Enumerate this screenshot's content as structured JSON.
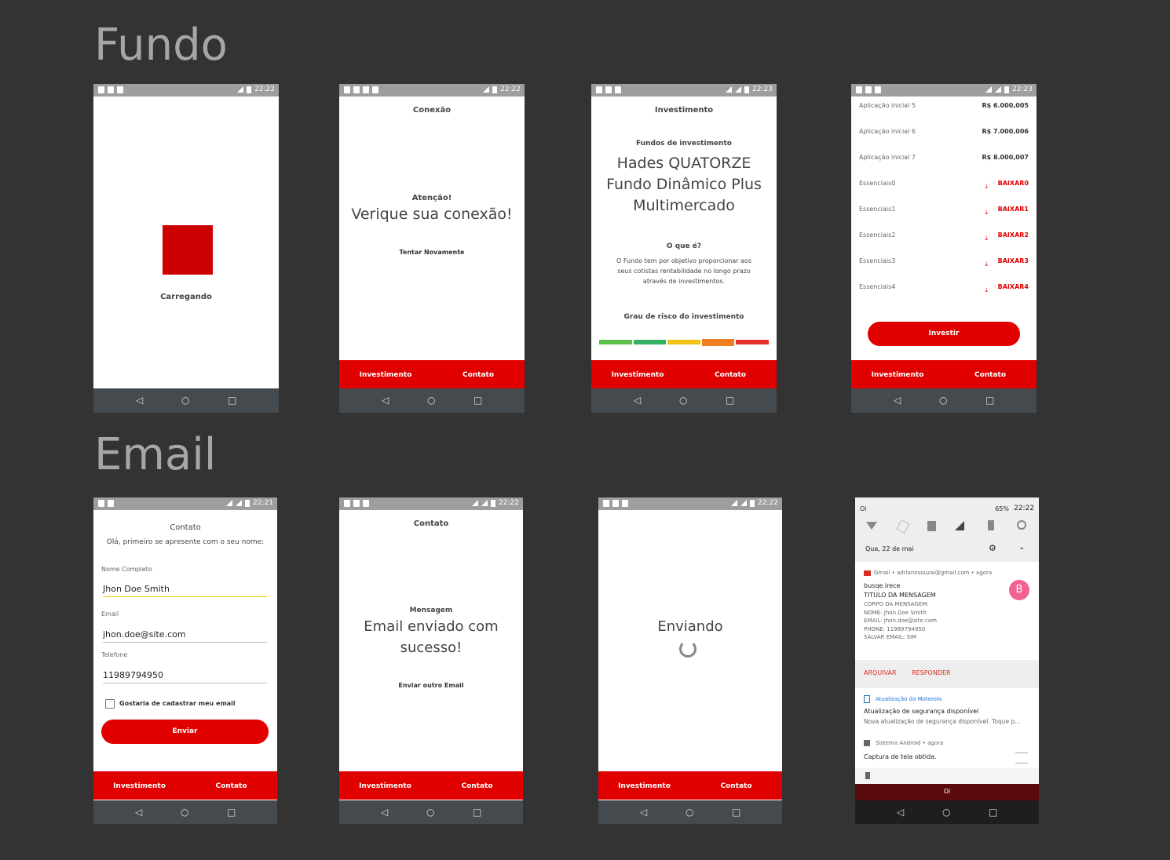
{
  "sections": {
    "fundo": "Fundo",
    "email": "Email"
  },
  "status_times": {
    "t2222": "22:22",
    "t2223": "22:23",
    "t2221": "22:21"
  },
  "tabs": {
    "left": "Investimento",
    "right": "Contato"
  },
  "nav_icons": {
    "back": "◁",
    "home": "○",
    "recent": "□"
  },
  "colors": {
    "accent": "#e10000",
    "background": "#333333",
    "loading_square": "#cc0000"
  },
  "loading": {
    "label": "Carregando"
  },
  "connection": {
    "header": "Conexão",
    "attention": "Atenção!",
    "message": "Verique sua conexão!",
    "retry": "Tentar Novamente"
  },
  "investment": {
    "header": "Investimento",
    "subtitle": "Fundos de investimento",
    "fund_line1": "Hades QUATORZE",
    "fund_line2": "Fundo Dinâmico Plus",
    "fund_line3": "Multimercado",
    "what_title": "O que é?",
    "what_line1": "O Fundo tem por objetivo proporcionar aos",
    "what_line2": "seus cotistas rentabilidade no longo prazo",
    "what_line3": "através de investimentos.",
    "risk_title": "Grau de risco do investimento",
    "risk_colors": [
      "#5cc24a",
      "#33b060",
      "#f2c315",
      "#f07f22",
      "#e8302a"
    ],
    "risk_level": 4
  },
  "investment_list": {
    "rows": [
      {
        "label": "Aplicação inicial 5",
        "value": "R$ 6.000,005"
      },
      {
        "label": "Aplicação inicial 6",
        "value": "R$ 7.000,006"
      },
      {
        "label": "Aplicação inicial 7",
        "value": "R$ 8.000,007"
      }
    ],
    "downloads": [
      {
        "label": "Essenciais0",
        "action": "BAIXAR0"
      },
      {
        "label": "Essenciais1",
        "action": "BAIXAR1"
      },
      {
        "label": "Essenciais2",
        "action": "BAIXAR2"
      },
      {
        "label": "Essenciais3",
        "action": "BAIXAR3"
      },
      {
        "label": "Essenciais4",
        "action": "BAIXAR4"
      }
    ],
    "download_icon": "⤓",
    "invest_button": "Investir"
  },
  "contact_form": {
    "header": "Contato",
    "intro": "Olá, primeiro se apresente com o seu nome:",
    "name_label": "Nome Completo",
    "name_value": "Jhon Doe Smith",
    "email_label": "Email",
    "email_value": "jhon.doe@site.com",
    "phone_label": "Telefone",
    "phone_value": "11989794950",
    "checkbox_label": "Gostaria de cadastrar meu email",
    "submit": "Enviar"
  },
  "sent": {
    "header": "Contato",
    "message_title": "Mensagem",
    "line1": "Email enviado com",
    "line2": "sucesso!",
    "again": "Enviar outro Email"
  },
  "sending": {
    "label": "Enviando"
  },
  "notifications": {
    "carrier": "Oi",
    "battery": "65%",
    "time": "22:22",
    "date": "Qua, 22 de mai",
    "gmail": {
      "app": "Gmail • adrianosouzai@gmail.com • agora",
      "sender": "busqe.irece",
      "avatar": "B",
      "title": "TITULO DA MENSAGEM",
      "lines": [
        "CORPO DA MENSAGEM:",
        "NOME: Jhon Doe Smith",
        "EMAIL: jhon.doe@site.com",
        "PHONE: 11989794950",
        "SALVAR EMAIL: SIM"
      ],
      "archive": "ARQUIVAR",
      "reply": "RESPONDER"
    },
    "motorola": {
      "app": "Atualização da Motorola",
      "title": "Atualização de segurança disponível",
      "text": "Nova atualização de segurança disponível. Toque p..."
    },
    "android": {
      "app": "Sistema Android • agora",
      "title": "Captura de tela obtida."
    },
    "bottom_carrier": "Oi"
  }
}
